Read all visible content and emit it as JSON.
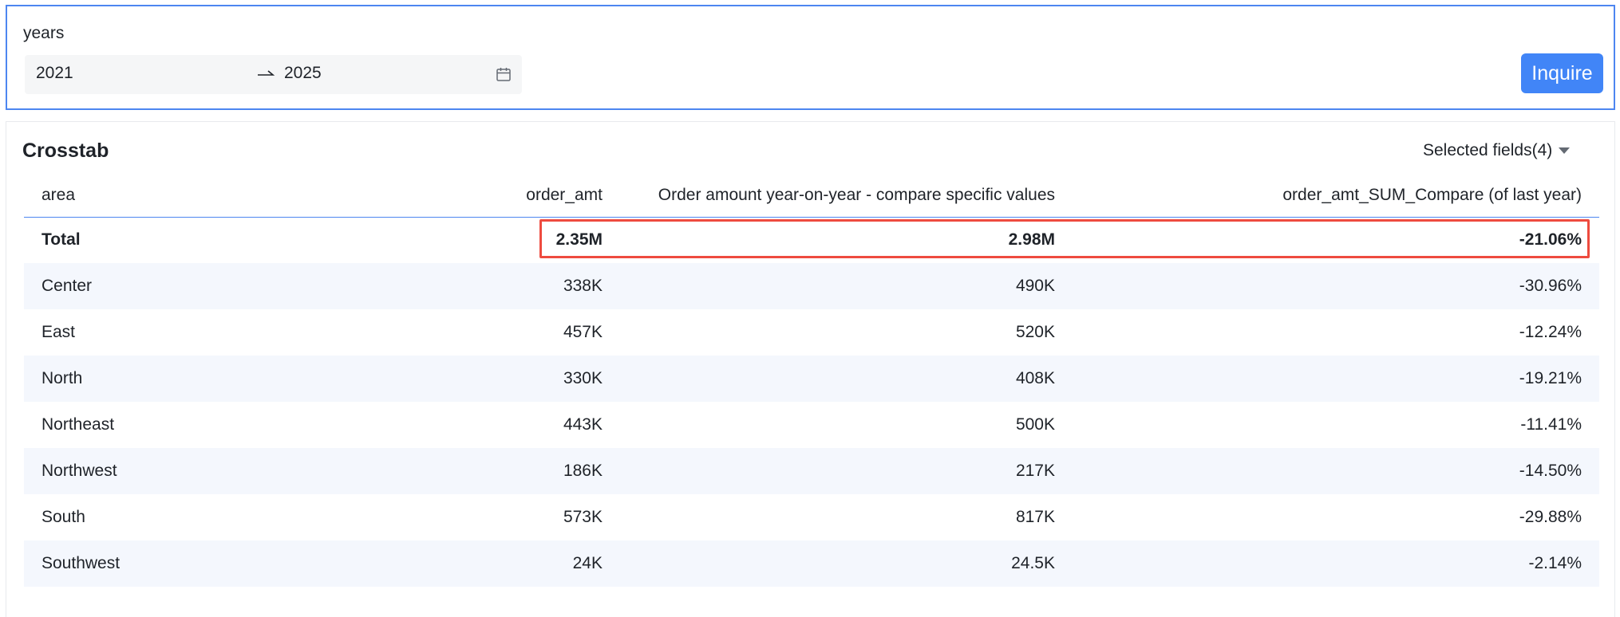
{
  "filter": {
    "label": "years",
    "range_start": "2021",
    "range_end": "2025",
    "inquire_label": "Inquire"
  },
  "crosstab": {
    "title": "Crosstab",
    "selected_fields_label": "Selected fields(4)",
    "columns": [
      "area",
      "order_amt",
      "Order amount year-on-year - compare specific values",
      "order_amt_SUM_Compare (of last year)"
    ],
    "rows": [
      {
        "area": "Total",
        "order_amt": "2.35M",
        "yoy_value": "2.98M",
        "compare_pct": "-21.06%"
      },
      {
        "area": "Center",
        "order_amt": "338K",
        "yoy_value": "490K",
        "compare_pct": "-30.96%"
      },
      {
        "area": "East",
        "order_amt": "457K",
        "yoy_value": "520K",
        "compare_pct": "-12.24%"
      },
      {
        "area": "North",
        "order_amt": "330K",
        "yoy_value": "408K",
        "compare_pct": "-19.21%"
      },
      {
        "area": "Northeast",
        "order_amt": "443K",
        "yoy_value": "500K",
        "compare_pct": "-11.41%"
      },
      {
        "area": "Northwest",
        "order_amt": "186K",
        "yoy_value": "217K",
        "compare_pct": "-14.50%"
      },
      {
        "area": "South",
        "order_amt": "573K",
        "yoy_value": "817K",
        "compare_pct": "-29.88%"
      },
      {
        "area": "Southwest",
        "order_amt": "24K",
        "yoy_value": "24.5K",
        "compare_pct": "-2.14%"
      }
    ]
  },
  "colors": {
    "accent": "#4185f7",
    "highlight": "#ee4b3f",
    "stripe": "#f4f7fd"
  },
  "icons": {
    "range_separator": "arrow-right-icon",
    "calendar": "calendar-icon",
    "dropdown": "caret-down-icon"
  }
}
